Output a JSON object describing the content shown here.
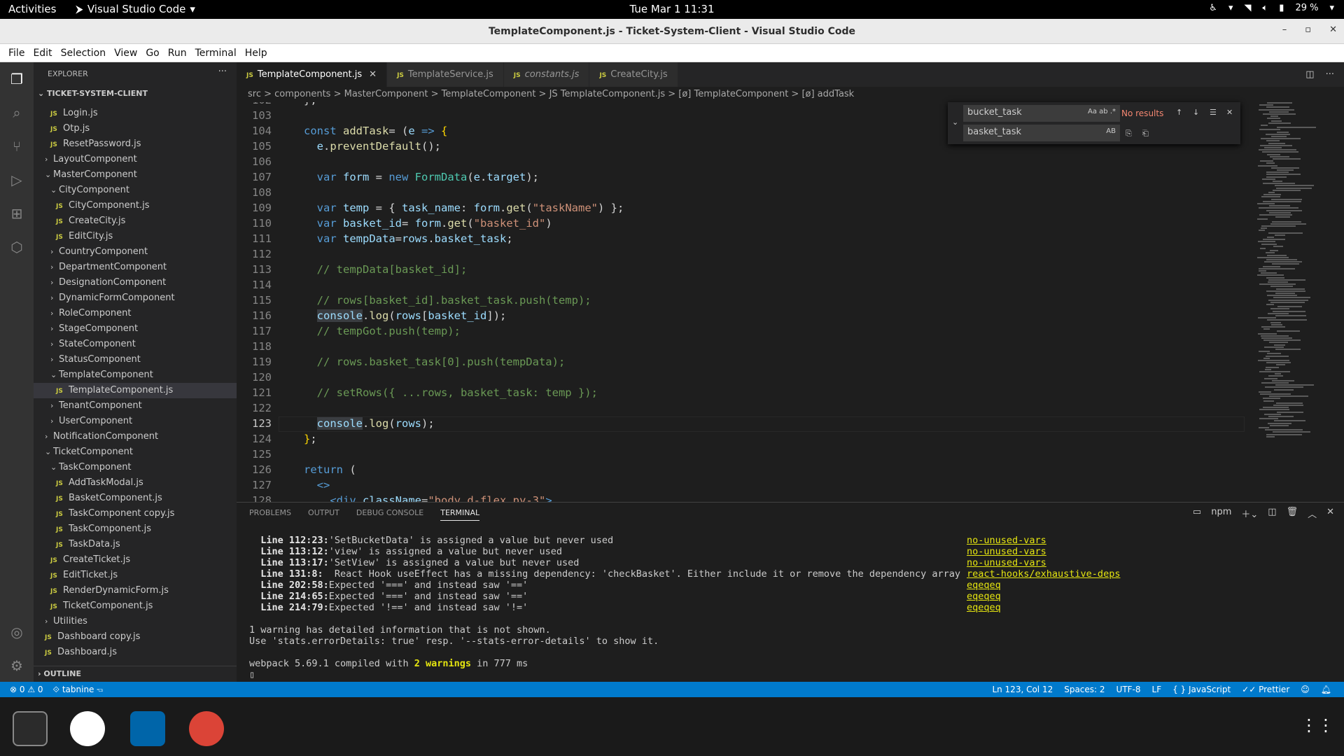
{
  "system": {
    "activities": "Activities",
    "app": "Visual Studio Code",
    "clock": "Tue Mar 1  11:31",
    "battery": "29 %"
  },
  "window": {
    "title": "TemplateComponent.js - Ticket-System-Client - Visual Studio Code"
  },
  "menu": [
    "File",
    "Edit",
    "Selection",
    "View",
    "Go",
    "Run",
    "Terminal",
    "Help"
  ],
  "explorer": {
    "header": "EXPLORER",
    "root": "TICKET-SYSTEM-CLIENT",
    "outline": "OUTLINE",
    "rows": [
      {
        "label": "Login.js",
        "depth": 2,
        "type": "file"
      },
      {
        "label": "Otp.js",
        "depth": 2,
        "type": "file"
      },
      {
        "label": "ResetPassword.js",
        "depth": 2,
        "type": "file"
      },
      {
        "label": "LayoutComponent",
        "depth": 1,
        "type": "folder"
      },
      {
        "label": "MasterComponent",
        "depth": 1,
        "type": "open"
      },
      {
        "label": "CityComponent",
        "depth": 2,
        "type": "open"
      },
      {
        "label": "CityComponent.js",
        "depth": 3,
        "type": "file"
      },
      {
        "label": "CreateCity.js",
        "depth": 3,
        "type": "file"
      },
      {
        "label": "EditCity.js",
        "depth": 3,
        "type": "file"
      },
      {
        "label": "CountryComponent",
        "depth": 2,
        "type": "folder"
      },
      {
        "label": "DepartmentComponent",
        "depth": 2,
        "type": "folder"
      },
      {
        "label": "DesignationComponent",
        "depth": 2,
        "type": "folder"
      },
      {
        "label": "DynamicFormComponent",
        "depth": 2,
        "type": "folder"
      },
      {
        "label": "RoleComponent",
        "depth": 2,
        "type": "folder"
      },
      {
        "label": "StageComponent",
        "depth": 2,
        "type": "folder"
      },
      {
        "label": "StateComponent",
        "depth": 2,
        "type": "folder"
      },
      {
        "label": "StatusComponent",
        "depth": 2,
        "type": "folder"
      },
      {
        "label": "TemplateComponent",
        "depth": 2,
        "type": "open"
      },
      {
        "label": "TemplateComponent.js",
        "depth": 3,
        "type": "file",
        "selected": true
      },
      {
        "label": "TenantComponent",
        "depth": 2,
        "type": "folder"
      },
      {
        "label": "UserComponent",
        "depth": 2,
        "type": "folder"
      },
      {
        "label": "NotificationComponent",
        "depth": 1,
        "type": "folder"
      },
      {
        "label": "TicketComponent",
        "depth": 1,
        "type": "open"
      },
      {
        "label": "TaskComponent",
        "depth": 2,
        "type": "open"
      },
      {
        "label": "AddTaskModal.js",
        "depth": 3,
        "type": "file"
      },
      {
        "label": "BasketComponent.js",
        "depth": 3,
        "type": "file"
      },
      {
        "label": "TaskComponent copy.js",
        "depth": 3,
        "type": "file"
      },
      {
        "label": "TaskComponent.js",
        "depth": 3,
        "type": "file"
      },
      {
        "label": "TaskData.js",
        "depth": 3,
        "type": "file"
      },
      {
        "label": "CreateTicket.js",
        "depth": 2,
        "type": "file"
      },
      {
        "label": "EditTicket.js",
        "depth": 2,
        "type": "file"
      },
      {
        "label": "RenderDynamicForm.js",
        "depth": 2,
        "type": "file"
      },
      {
        "label": "TicketComponent.js",
        "depth": 2,
        "type": "file"
      },
      {
        "label": "Utilities",
        "depth": 1,
        "type": "folder"
      },
      {
        "label": "Dashboard copy.js",
        "depth": 1,
        "type": "file"
      },
      {
        "label": "Dashboard.js",
        "depth": 1,
        "type": "file"
      }
    ]
  },
  "tabs": [
    {
      "label": "TemplateComponent.js",
      "active": true,
      "italic": false
    },
    {
      "label": "TemplateService.js",
      "active": false,
      "italic": false
    },
    {
      "label": "constants.js",
      "active": false,
      "italic": true
    },
    {
      "label": "CreateCity.js",
      "active": false,
      "italic": false
    }
  ],
  "breadcrumb": "src  >  components  >  MasterComponent  >  TemplateComponent  >  JS  TemplateComponent.js  >  [ø] TemplateComponent  >  [ø] addTask",
  "editor": {
    "first_line": 102,
    "current_line": 123,
    "lines": [
      [
        [
          "",
          "};"
        ]
      ],
      [],
      [
        [
          "kw",
          "const "
        ],
        [
          "fn",
          "addTask"
        ],
        [
          "",
          "= ("
        ],
        [
          "vr",
          "e"
        ],
        [
          "",
          " "
        ],
        [
          "kw",
          "=>"
        ],
        [
          "",
          " "
        ],
        [
          "br",
          "{"
        ]
      ],
      [
        [
          "",
          "  "
        ],
        [
          "vr",
          "e"
        ],
        [
          "",
          "."
        ],
        [
          "fn",
          "preventDefault"
        ],
        [
          "",
          "();"
        ]
      ],
      [],
      [
        [
          "",
          "  "
        ],
        [
          "kw",
          "var "
        ],
        [
          "vr",
          "form"
        ],
        [
          "",
          " = "
        ],
        [
          "kw",
          "new "
        ],
        [
          "cls",
          "FormData"
        ],
        [
          "",
          "("
        ],
        [
          "vr",
          "e"
        ],
        [
          "",
          "."
        ],
        [
          "vr",
          "target"
        ],
        [
          "",
          ");"
        ]
      ],
      [],
      [
        [
          "",
          "  "
        ],
        [
          "kw",
          "var "
        ],
        [
          "vr",
          "temp"
        ],
        [
          "",
          " = { "
        ],
        [
          "vr",
          "task_name"
        ],
        [
          "",
          ": "
        ],
        [
          "vr",
          "form"
        ],
        [
          "",
          "."
        ],
        [
          "fn",
          "get"
        ],
        [
          "",
          "("
        ],
        [
          "str",
          "\"taskName\""
        ],
        [
          "",
          ") };"
        ]
      ],
      [
        [
          "",
          "  "
        ],
        [
          "kw",
          "var "
        ],
        [
          "vr",
          "basket_id"
        ],
        [
          "",
          "= "
        ],
        [
          "vr",
          "form"
        ],
        [
          "",
          "."
        ],
        [
          "fn",
          "get"
        ],
        [
          "",
          "("
        ],
        [
          "str",
          "\"basket_id\""
        ],
        [
          "",
          ")"
        ]
      ],
      [
        [
          "",
          "  "
        ],
        [
          "kw",
          "var "
        ],
        [
          "vr",
          "tempData"
        ],
        [
          "",
          "="
        ],
        [
          "vr",
          "rows"
        ],
        [
          "",
          "."
        ],
        [
          "vr",
          "basket_task"
        ],
        [
          "",
          ";"
        ]
      ],
      [],
      [
        [
          "",
          "  "
        ],
        [
          "cm",
          "// tempData[basket_id];"
        ]
      ],
      [],
      [
        [
          "",
          "  "
        ],
        [
          "cm",
          "// rows[basket_id].basket_task.push(temp);"
        ]
      ],
      [
        [
          "",
          "  "
        ],
        [
          "vrh",
          "console"
        ],
        [
          "",
          "."
        ],
        [
          "fn",
          "log"
        ],
        [
          "",
          "("
        ],
        [
          "vr",
          "rows"
        ],
        [
          "",
          "["
        ],
        [
          "vr",
          "basket_id"
        ],
        [
          "",
          "]);"
        ]
      ],
      [
        [
          "",
          "  "
        ],
        [
          "cm",
          "// tempGot.push(temp);"
        ]
      ],
      [],
      [
        [
          "",
          "  "
        ],
        [
          "cm",
          "// rows.basket_task[0].push(tempData);"
        ]
      ],
      [],
      [
        [
          "",
          "  "
        ],
        [
          "cm",
          "// setRows({ ...rows, basket_task: temp });"
        ]
      ],
      [],
      [
        [
          "",
          "  "
        ],
        [
          "vrh",
          "console"
        ],
        [
          "",
          "."
        ],
        [
          "fn",
          "log"
        ],
        [
          "",
          "("
        ],
        [
          "vr",
          "rows"
        ],
        [
          "",
          ");"
        ]
      ],
      [
        [
          "br",
          "}"
        ],
        [
          "",
          ";"
        ]
      ],
      [],
      [
        [
          "kw",
          "return "
        ],
        [
          "",
          "("
        ]
      ],
      [
        [
          "",
          "  "
        ],
        [
          "kw",
          "<>"
        ]
      ],
      [
        [
          "",
          "    "
        ],
        [
          "kw",
          "<div "
        ],
        [
          "vr",
          "className"
        ],
        [
          "",
          "="
        ],
        [
          "str",
          "\"body d-flex py-3\""
        ],
        [
          "kw",
          ">"
        ]
      ]
    ]
  },
  "find": {
    "search": "bucket_task",
    "replace": "basket_task",
    "result": "No results"
  },
  "panel": {
    "tabs": [
      "PROBLEMS",
      "OUTPUT",
      "DEBUG CONSOLE",
      "TERMINAL"
    ],
    "active": "TERMINAL",
    "shell": "npm",
    "warnings": [
      {
        "loc": "Line 112:23:",
        "msg": "'SetBucketData' is assigned a value but never used",
        "rule": "no-unused-vars"
      },
      {
        "loc": "Line 113:12:",
        "msg": "'view' is assigned a value but never used",
        "rule": "no-unused-vars"
      },
      {
        "loc": "Line 113:17:",
        "msg": "'SetView' is assigned a value but never used",
        "rule": "no-unused-vars"
      },
      {
        "loc": "Line 131:8:",
        "msg": " React Hook useEffect has a missing dependency: 'checkBasket'. Either include it or remove the dependency array",
        "rule": "react-hooks/exhaustive-deps"
      },
      {
        "loc": "Line 202:58:",
        "msg": "Expected '===' and instead saw '=='",
        "rule": "eqeqeq"
      },
      {
        "loc": "Line 214:65:",
        "msg": "Expected '===' and instead saw '=='",
        "rule": "eqeqeq"
      },
      {
        "loc": "Line 214:79:",
        "msg": "Expected '!==' and instead saw '!='",
        "rule": "eqeqeq"
      }
    ],
    "info1": "1 warning has detailed information that is not shown.",
    "info2": "Use 'stats.errorDetails: true' resp. '--stats-error-details' to show it.",
    "compile_pre": "webpack 5.69.1 compiled with ",
    "compile_warn": "2 warnings",
    "compile_post": " in 777 ms"
  },
  "status": {
    "errors": "0",
    "warnings": "0",
    "tabnine": "tabnine",
    "position": "Ln 123, Col 12",
    "spaces": "Spaces: 2",
    "encoding": "UTF-8",
    "eol": "LF",
    "language": "JavaScript",
    "prettier": "Prettier"
  },
  "colors": {
    "accent": "#007acc",
    "keyword": "#569cd6",
    "function": "#dcdcaa",
    "variable": "#9cdcfe",
    "string": "#ce9178",
    "comment": "#6a9955"
  }
}
